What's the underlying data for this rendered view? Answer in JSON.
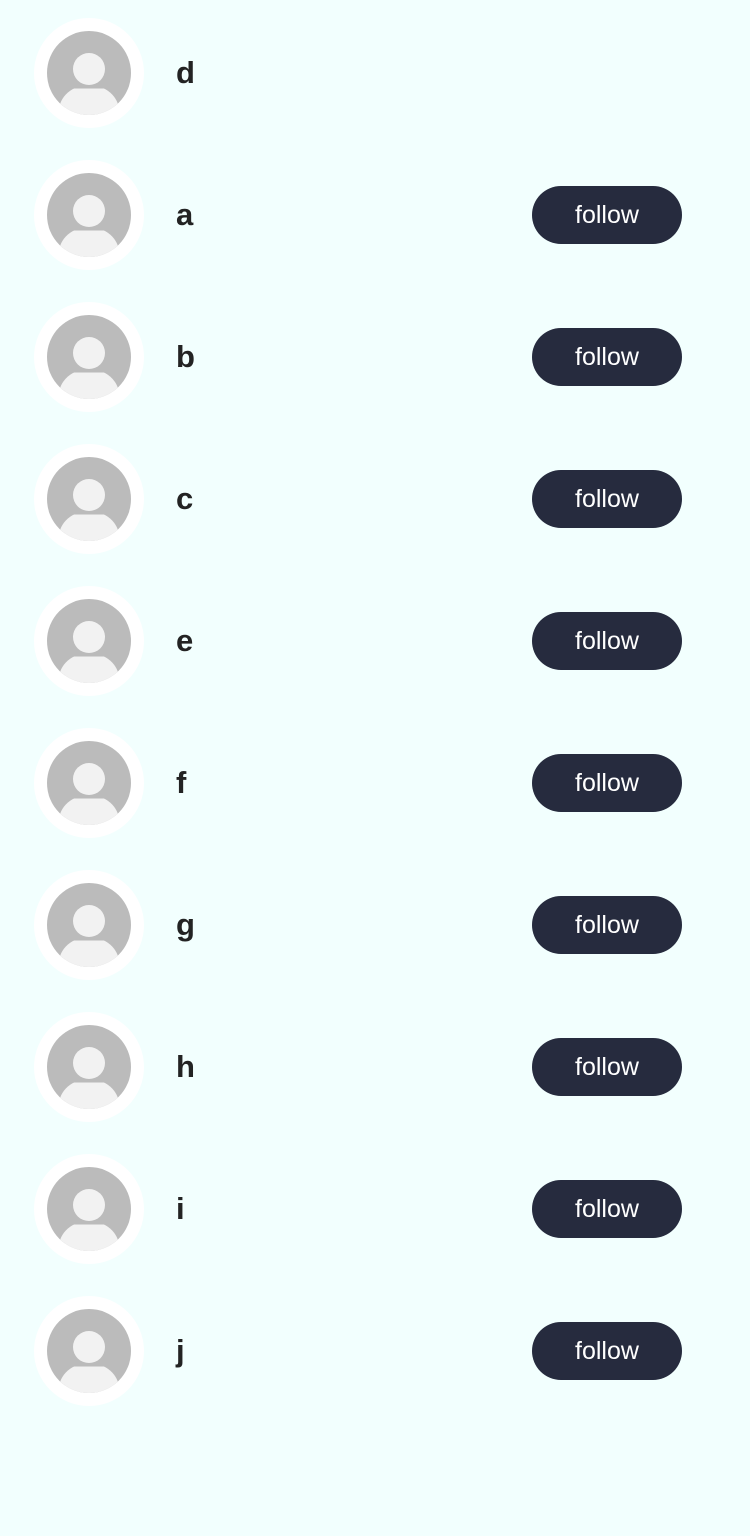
{
  "users": [
    {
      "name": "d",
      "follow_label": ""
    },
    {
      "name": "a",
      "follow_label": "follow"
    },
    {
      "name": "b",
      "follow_label": "follow"
    },
    {
      "name": "c",
      "follow_label": "follow"
    },
    {
      "name": "e",
      "follow_label": "follow"
    },
    {
      "name": "f",
      "follow_label": "follow"
    },
    {
      "name": "g",
      "follow_label": "follow"
    },
    {
      "name": "h",
      "follow_label": "follow"
    },
    {
      "name": "i",
      "follow_label": "follow"
    },
    {
      "name": "j",
      "follow_label": "follow"
    }
  ],
  "colors": {
    "background": "#f2fffe",
    "button": "#262b3e",
    "button_text": "#ffffff",
    "avatar_placeholder": "#bbbbbb"
  },
  "icons": {
    "avatar": "default-user-avatar-icon"
  }
}
